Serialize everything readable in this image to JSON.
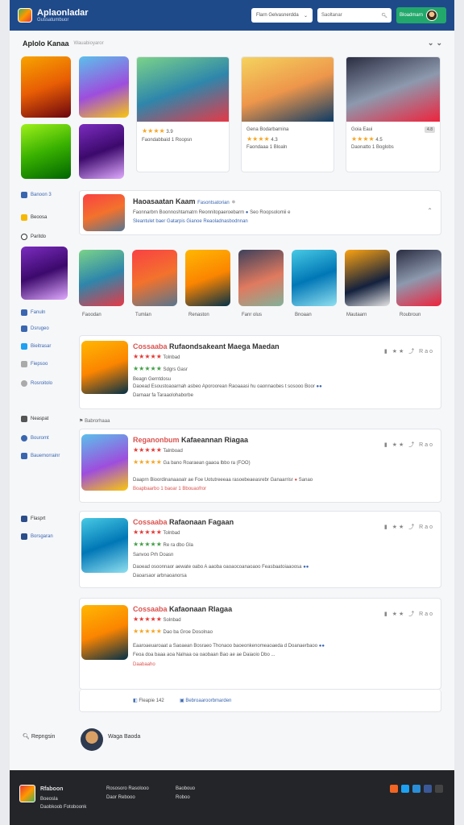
{
  "header": {
    "app_title": "Aplaonladar",
    "app_subtitle": "Gussatumbuor",
    "filter_select": "Flarn Gelvasnerdda",
    "search_placeholder": "Saoltanar",
    "account_label": "Bloadmarn"
  },
  "featured": {
    "title": "Aplolo Kanaa",
    "subtitle": "Wauabioyaror",
    "cards": [
      {
        "rating_text": "3.9",
        "footer": "Faondabbaid 1 Roopsn"
      },
      {
        "title": "Gena Bodarbarnina",
        "rating_text": "4.3",
        "footer": "Faondaaa 1 Bloaln"
      },
      {
        "title": "Goia Eaui",
        "tag": "4.8",
        "rating_text": "4.5",
        "footer": "Daonatto 1 Boglobs"
      }
    ]
  },
  "sidebar": {
    "items": [
      "Banoon 3",
      "Beoosa",
      "Paritdo",
      "Fanuln",
      "Dsrugeo",
      "Bieitrasar",
      "Fiepsoo",
      "Rosroitolo",
      "Neaspat",
      "Bouromt",
      "Bauemorrainr",
      "Flasprt",
      "Borsgaran"
    ]
  },
  "highlight": {
    "title": "Haoasaatan Kaam",
    "badge": "Fasontsatorian",
    "line1": "Faonnarbrn Boonnoshtamatrn Reonnitopaeroebarm",
    "line1_right": "Seo Roopsolomii e",
    "line2": "Sleantulet baer Gatarpis Gianoe Reaoladnasbodnnan"
  },
  "strip": {
    "labels": [
      "Faoodan",
      "Tumlan",
      "Renaston",
      "Fanr olus",
      "Bnoaan",
      "Mautaarn",
      "Roubroun"
    ]
  },
  "list": [
    {
      "title_red": "Cossaaba",
      "title": "Rufaondsakeant Maega Maedan",
      "score": "Tolnbad",
      "line1": "Sdgrs Gasr",
      "line2": "Beagn Gerntdosu",
      "desc": "Daoead Esoustoaoarnah asbeo Aporoorean Raoaaasi hu oaonnaobes t sosooo Boor",
      "tags": "Darnaar fa Taraaolohaborbe"
    },
    {
      "title_red": "Reganonbum",
      "title": "Kafaeannan Riagaa",
      "score": "Talnboad",
      "line1": "Ga bano Roaraean gaaoa lbbo ra (FOO)",
      "desc": "Daaprn Bioordinanaaoalr ae Foe Uotutreeeaa rasoebeaeasrebr Ganaarrisr",
      "aux": "Sanao",
      "tags": "Boapbaarbo 1 baoar 1 Bbouaofror"
    },
    {
      "title_red": "Cossaaba",
      "title": "Rafaonaan Fagaan",
      "score": "Tolnbad",
      "line1": "Re ra dbo Gla",
      "line2": "Sanvoo Prh Doasn",
      "desc": "Daoead osoonnaor aewate oabo A aaoba oaoaocoanaoaoo Feasbaatoiaaoosa",
      "tags": "Daoarsaor arbnaoanorsa"
    },
    {
      "title_red": "Cossaaba",
      "title": "Kafaonaan Rlagaa",
      "score": "Solnbad",
      "line1": "Dao ba Groe Dosolnao",
      "desc": "Eaaroaeuaroaat a Saoaean Bosraeo Thonaoo baoeonkenomeaoaeda d Doanaerbaoo",
      "desc2": "Feoa doa baaa aoa Nalnaa oa oaobaan Bao ae ae Daiaoio Dbo ...",
      "tags": "Daabaaho"
    }
  ],
  "sublabel": "Babrorhaaa",
  "pager": {
    "prev": "Fleapie 142",
    "next": "Bebroaaroorbmarden"
  },
  "bottom_user": {
    "search_label": "Repngsin",
    "name": "Waga Baoda"
  },
  "footer": {
    "brand": "Rfaboon",
    "sub1": "Boeosla",
    "sub2": "Daobkoob Fotoboonk",
    "col1": [
      "Rososoro Rasolooo",
      "Daor Rebooo"
    ],
    "col2": [
      "Baobouo",
      "Roboo"
    ]
  }
}
